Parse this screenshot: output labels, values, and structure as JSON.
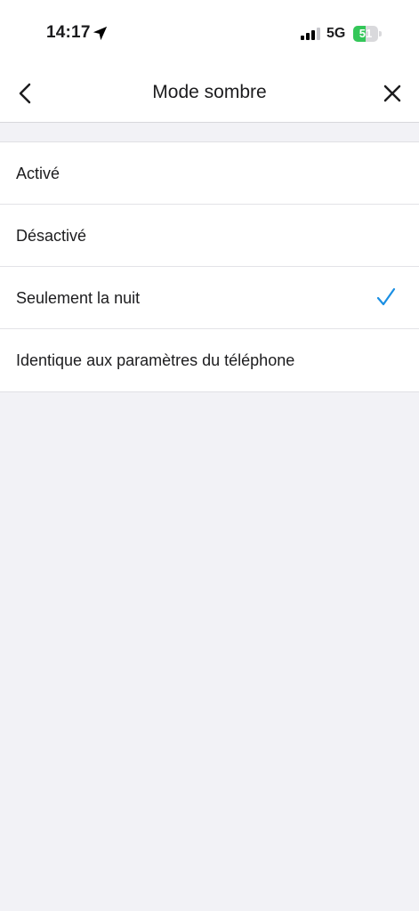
{
  "status_bar": {
    "time": "14:17",
    "network": "5G",
    "battery_level": "51",
    "battery_color": "#34c759",
    "icons": [
      "location-arrow-icon",
      "cellular-signal-icon",
      "battery-icon"
    ]
  },
  "nav": {
    "title": "Mode sombre",
    "back_icon": "chevron-left-icon",
    "close_icon": "close-icon"
  },
  "options": [
    {
      "label": "Activé",
      "selected": false
    },
    {
      "label": "Désactivé",
      "selected": false
    },
    {
      "label": "Seulement la nuit",
      "selected": true
    },
    {
      "label": "Identique aux paramètres du téléphone",
      "selected": false
    }
  ],
  "accent_color": "#1a8fe3"
}
